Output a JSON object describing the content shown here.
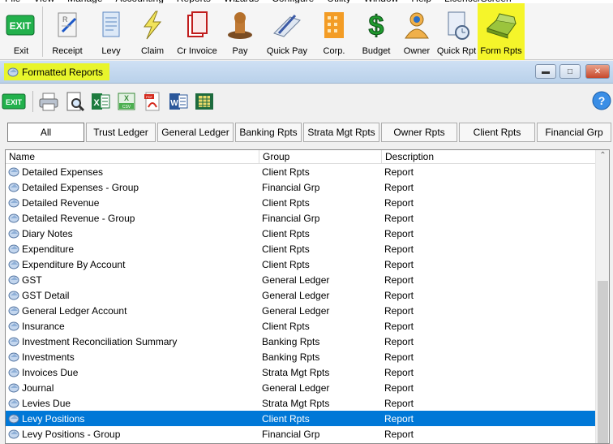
{
  "menubar": [
    "File",
    "View",
    "Manage",
    "Accounting",
    "Reports",
    "Wizards",
    "Configure",
    "Utility",
    "Window",
    "Help",
    "Licence/Screen"
  ],
  "toolbar": [
    {
      "label": "Exit",
      "icon": "exit-icon"
    },
    {
      "label": "Receipt",
      "icon": "receipt-icon"
    },
    {
      "label": "Levy",
      "icon": "levy-icon"
    },
    {
      "label": "Claim",
      "icon": "claim-icon"
    },
    {
      "label": "Cr Invoice",
      "icon": "cr-invoice-icon"
    },
    {
      "label": "Pay",
      "icon": "pay-icon"
    },
    {
      "label": "Quick Pay",
      "icon": "quick-pay-icon"
    },
    {
      "label": "Corp.",
      "icon": "corp-icon"
    },
    {
      "label": "Budget",
      "icon": "budget-icon"
    },
    {
      "label": "Owner",
      "icon": "owner-icon"
    },
    {
      "label": "Quick Rpt",
      "icon": "quick-rpt-icon"
    },
    {
      "label": "Form Rpts",
      "icon": "form-rpts-icon"
    }
  ],
  "window": {
    "title": "Formatted Reports",
    "exit_label": "EXIT"
  },
  "tabs": [
    "All",
    "Trust Ledger",
    "General Ledger",
    "Banking Rpts",
    "Strata Mgt Rpts",
    "Owner Rpts",
    "Client Rpts",
    "Financial Grp"
  ],
  "columns": [
    "Name",
    "Group",
    "Description"
  ],
  "rows": [
    {
      "name": "Detailed Expenses",
      "group": "Client Rpts",
      "desc": "Report"
    },
    {
      "name": "Detailed Expenses - Group",
      "group": "Financial Grp",
      "desc": "Report"
    },
    {
      "name": "Detailed Revenue",
      "group": "Client Rpts",
      "desc": "Report"
    },
    {
      "name": "Detailed Revenue - Group",
      "group": "Financial Grp",
      "desc": "Report"
    },
    {
      "name": "Diary Notes",
      "group": "Client Rpts",
      "desc": "Report"
    },
    {
      "name": "Expenditure",
      "group": "Client Rpts",
      "desc": "Report"
    },
    {
      "name": "Expenditure By Account",
      "group": "Client Rpts",
      "desc": "Report"
    },
    {
      "name": "GST",
      "group": "General Ledger",
      "desc": "Report"
    },
    {
      "name": "GST Detail",
      "group": "General Ledger",
      "desc": "Report"
    },
    {
      "name": "General Ledger Account",
      "group": "General Ledger",
      "desc": "Report"
    },
    {
      "name": "Insurance",
      "group": "Client Rpts",
      "desc": "Report"
    },
    {
      "name": "Investment Reconciliation Summary",
      "group": "Banking Rpts",
      "desc": "Report"
    },
    {
      "name": "Investments",
      "group": "Banking Rpts",
      "desc": "Report"
    },
    {
      "name": "Invoices Due",
      "group": "Strata Mgt Rpts",
      "desc": "Report"
    },
    {
      "name": "Journal",
      "group": "General Ledger",
      "desc": "Report"
    },
    {
      "name": "Levies Due",
      "group": "Strata Mgt Rpts",
      "desc": "Report"
    },
    {
      "name": "Levy Positions",
      "group": "Client Rpts",
      "desc": "Report",
      "selected": true
    },
    {
      "name": "Levy Positions - Group",
      "group": "Financial Grp",
      "desc": "Report"
    }
  ],
  "colors": {
    "highlight": "#f5f52a",
    "selection": "#0078d7"
  }
}
